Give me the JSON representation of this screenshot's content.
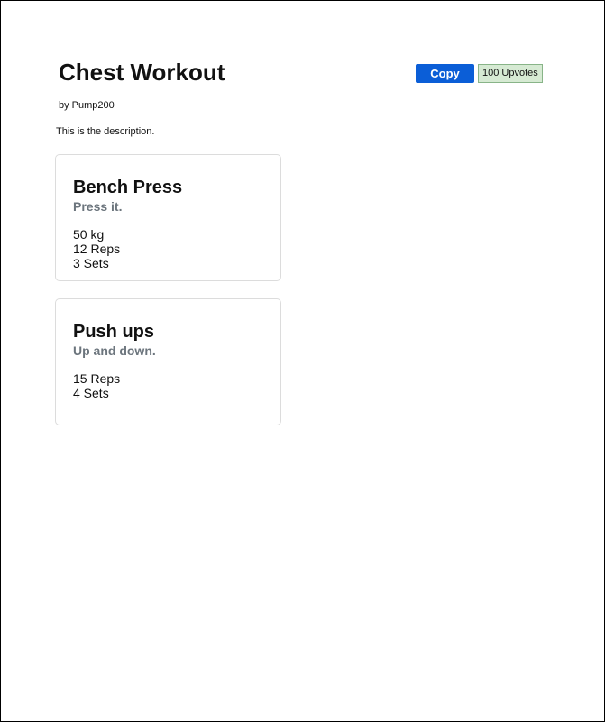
{
  "workout": {
    "title": "Chest Workout",
    "author": "by Pump200",
    "description": "This is the description."
  },
  "actions": {
    "copy_label": "Copy",
    "upvotes_label": "100 Upvotes"
  },
  "exercises": [
    {
      "name": "Bench Press",
      "description": "Press it.",
      "weight": "50 kg",
      "reps": "12 Reps",
      "sets": "3 Sets"
    },
    {
      "name": "Push ups",
      "description": "Up and down.",
      "reps": "15 Reps",
      "sets": "4 Sets"
    }
  ],
  "colors": {
    "copy_button": "#0b5ed7",
    "upvotes_background": "#d6ead3",
    "upvotes_border": "#88b488",
    "secondary_text": "#6c757d",
    "card_border": "#dcdcdc"
  }
}
